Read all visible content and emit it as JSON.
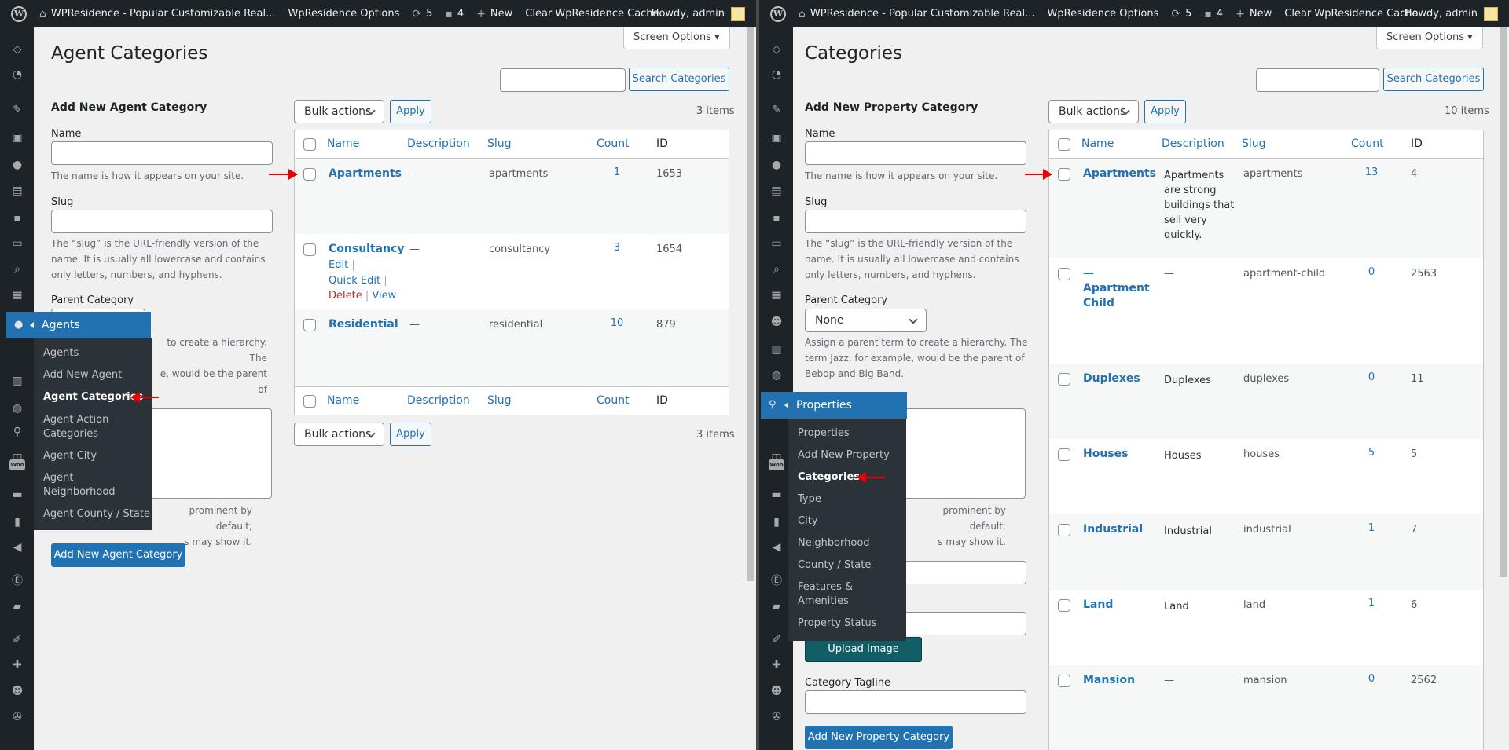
{
  "adminbar": {
    "site_name": "WPResidence - Popular Customizable Real...",
    "options": "WpResidence Options",
    "updates": "5",
    "comments": "4",
    "new_label": "New",
    "clear_cache": "Clear WpResidence Cache",
    "howdy": "Howdy, admin"
  },
  "left": {
    "page_title": "Agent Categories",
    "screen_options": "Screen Options",
    "search_button": "Search Categories",
    "form": {
      "heading": "Add New Agent Category",
      "name_label": "Name",
      "name_help": "The name is how it appears on your site.",
      "slug_label": "Slug",
      "slug_help": [
        "The “slug” is the URL-friendly version of the",
        "name. It is usually all lowercase and contains",
        "only letters, numbers, and hyphens."
      ],
      "parent_label": "Parent Category",
      "parent_help": [
        "to create a hierarchy. The",
        "e, would be the parent of"
      ],
      "desc_help": [
        "prominent by default;",
        "s may show it."
      ],
      "submit": "Add New Agent Category"
    },
    "bulk_actions": "Bulk actions",
    "apply": "Apply",
    "items_count": "3 items",
    "columns": {
      "name": "Name",
      "description": "Description",
      "slug": "Slug",
      "count": "Count",
      "id": "ID"
    },
    "rows": [
      {
        "name": "Apartments",
        "description": "—",
        "slug": "apartments",
        "count": "1",
        "id": "1653"
      },
      {
        "name": "Consultancy",
        "description": "—",
        "slug": "consultancy",
        "count": "3",
        "id": "1654"
      },
      {
        "name": "Residential",
        "description": "—",
        "slug": "residential",
        "count": "10",
        "id": "879"
      }
    ],
    "row_actions": {
      "edit": "Edit",
      "quick_edit": "Quick Edit",
      "delete": "Delete",
      "view": "View",
      "sep": "|"
    },
    "flyout": {
      "title": "Agents",
      "items": [
        "Agents",
        "Add New Agent",
        "Agent Categories",
        "Agent Action",
        "Categories",
        "Agent City",
        "Agent",
        "Neighborhood",
        "Agent County / State"
      ]
    }
  },
  "right": {
    "page_title": "Categories",
    "screen_options": "Screen Options",
    "search_button": "Search Categories",
    "form": {
      "heading": "Add New Property Category",
      "name_label": "Name",
      "name_help": "The name is how it appears on your site.",
      "slug_label": "Slug",
      "slug_help": [
        "The “slug” is the URL-friendly version of the",
        "name. It is usually all lowercase and contains",
        "only letters, numbers, and hyphens."
      ],
      "parent_label": "Parent Category",
      "parent_value": "None",
      "parent_help": [
        "Assign a parent term to create a hierarchy. The",
        "term Jazz, for example, would be the parent of",
        "Bebop and Big Band."
      ],
      "desc_help": [
        "prominent by default;",
        "s may show it."
      ],
      "upload_image": "Upload Image",
      "tagline_label": "Category Tagline",
      "submit": "Add New Property Category"
    },
    "bulk_actions": "Bulk actions",
    "apply": "Apply",
    "items_count": "10 items",
    "columns": {
      "name": "Name",
      "description": "Description",
      "slug": "Slug",
      "count": "Count",
      "id": "ID"
    },
    "rows": [
      {
        "name": "Apartments",
        "description": [
          "Apartments",
          "are strong",
          "buildings that",
          "sell very",
          "quickly."
        ],
        "slug": "apartments",
        "count": "13",
        "id": "4"
      },
      {
        "name": [
          "—",
          "Apartment",
          "Child"
        ],
        "description": "—",
        "slug": "apartment-child",
        "count": "0",
        "id": "2563"
      },
      {
        "name": "Duplexes",
        "description": "Duplexes",
        "slug": "duplexes",
        "count": "0",
        "id": "11"
      },
      {
        "name": "Houses",
        "description": "Houses",
        "slug": "houses",
        "count": "5",
        "id": "5"
      },
      {
        "name": "Industrial",
        "description": "Industrial",
        "slug": "industrial",
        "count": "1",
        "id": "7"
      },
      {
        "name": "Land",
        "description": "Land",
        "slug": "land",
        "count": "1",
        "id": "6"
      },
      {
        "name": "Mansion",
        "description": "—",
        "slug": "mansion",
        "count": "0",
        "id": "2562"
      }
    ],
    "flyout": {
      "title": "Properties",
      "items": [
        "Properties",
        "Add New Property",
        "Categories",
        "Type",
        "City",
        "Neighborhood",
        "County / State",
        "Features &",
        "Amenities",
        "Property Status"
      ]
    }
  },
  "colors": {
    "adminbar": "#1d2327",
    "accent": "#2271b1",
    "annotation_arrow": "#ee0000",
    "delete": "#b32d2e"
  }
}
